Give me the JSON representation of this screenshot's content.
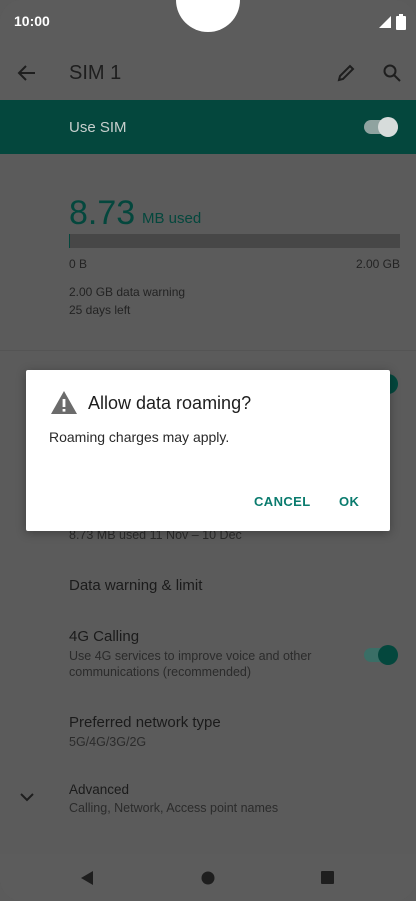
{
  "status_bar": {
    "time": "10:00"
  },
  "app_bar": {
    "title": "SIM 1",
    "back_icon": "back-arrow-icon",
    "edit_icon": "pencil-icon",
    "search_icon": "search-icon"
  },
  "use_sim": {
    "label": "Use SIM",
    "enabled": true
  },
  "usage": {
    "amount": "8.73",
    "unit": "MB used",
    "bar_fraction": 0.004,
    "min_label": "0 B",
    "max_label": "2.00 GB",
    "warning": "2.00 GB data warning",
    "days_left": "25 days left"
  },
  "settings": {
    "app_data_usage_sub": "8.73 MB used 11 Nov – 10 Dec",
    "data_warning": {
      "title": "Data warning & limit"
    },
    "calling": {
      "title": "4G Calling",
      "subtitle_1": "Use 4G services to improve voice and other",
      "subtitle_2": "communications (recommended)",
      "enabled": true
    },
    "network": {
      "title": "Preferred network type",
      "subtitle": "5G/4G/3G/2G"
    },
    "advanced": {
      "title": "Advanced",
      "subtitle": "Calling, Network, Access point names"
    }
  },
  "dialog": {
    "icon": "warning-icon",
    "title": "Allow data roaming?",
    "message": "Roaming charges may apply.",
    "cancel_label": "CANCEL",
    "ok_label": "OK"
  },
  "colors": {
    "accent": "#0a7b6e",
    "accent_dim": "#04473d",
    "scrim_bg": "#5b5b5b"
  }
}
